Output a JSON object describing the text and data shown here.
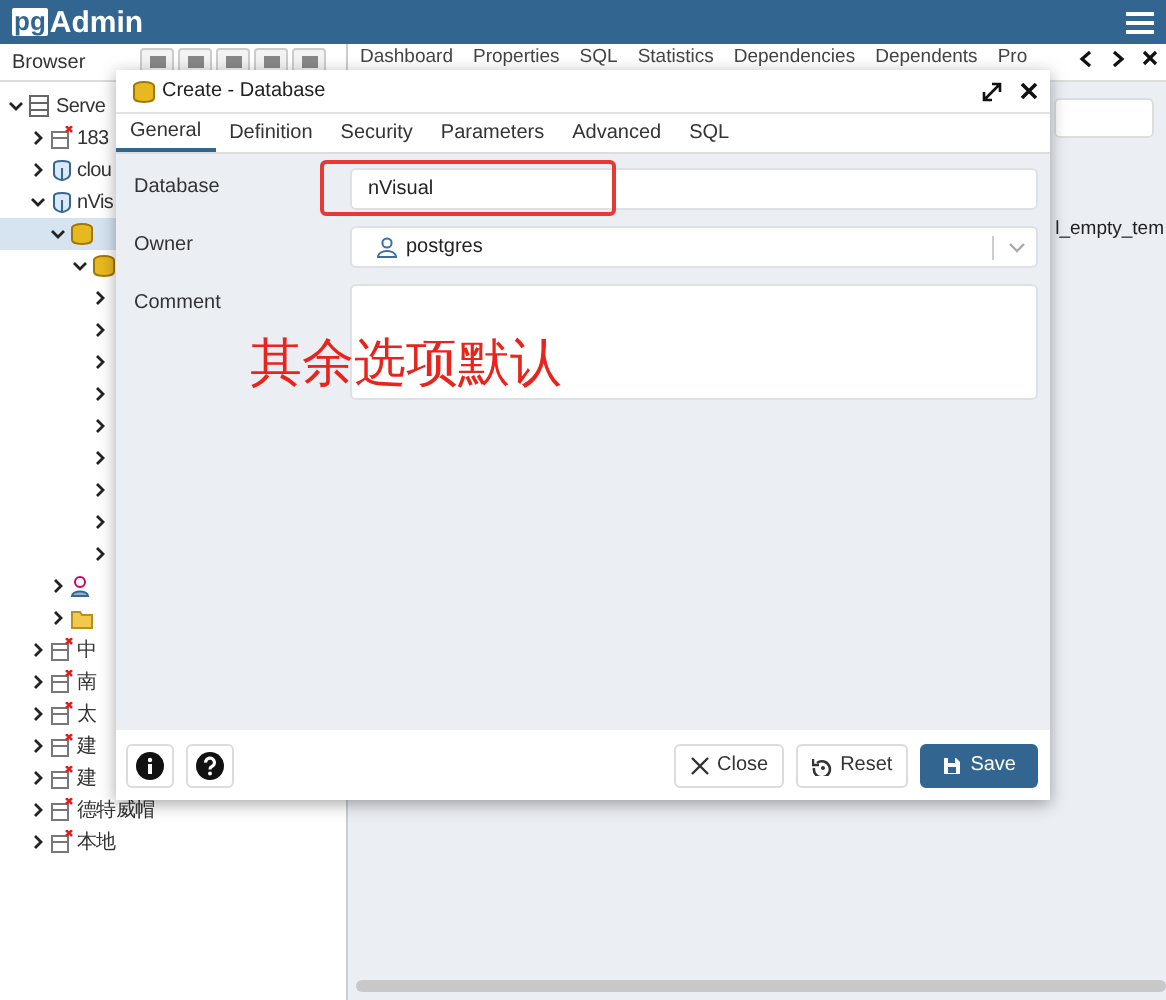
{
  "app": {
    "logo_badge": "pg",
    "logo_text": "Admin"
  },
  "browser": {
    "title": "Browser",
    "tree": [
      {
        "label": "Serve",
        "kind": "group",
        "expanded": true,
        "selected": false,
        "children": [
          {
            "label": "183",
            "kind": "offline",
            "expanded": false,
            "selected": false
          },
          {
            "label": "clou",
            "kind": "server",
            "expanded": false,
            "selected": false
          },
          {
            "label": "nVis",
            "kind": "server",
            "expanded": true,
            "selected": false,
            "children": [
              {
                "kind": "database",
                "expanded": true,
                "selected": true,
                "children": [
                  {
                    "kind": "database",
                    "expanded": true,
                    "selected": false,
                    "children": [
                      {
                        "expanded": false,
                        "selected": false
                      },
                      {
                        "expanded": false,
                        "selected": false
                      },
                      {
                        "expanded": false,
                        "selected": false
                      },
                      {
                        "expanded": false,
                        "selected": false
                      },
                      {
                        "expanded": false,
                        "selected": false
                      },
                      {
                        "expanded": false,
                        "selected": false
                      },
                      {
                        "expanded": false,
                        "selected": false
                      },
                      {
                        "expanded": false,
                        "selected": false
                      },
                      {
                        "expanded": false,
                        "selected": false
                      }
                    ]
                  }
                ]
              },
              {
                "kind": "roles",
                "expanded": false,
                "selected": false
              },
              {
                "kind": "folder",
                "expanded": false,
                "selected": false
              }
            ]
          },
          {
            "label": "中",
            "kind": "offline",
            "expanded": false,
            "selected": false
          },
          {
            "label": "南",
            "kind": "offline",
            "expanded": false,
            "selected": false
          },
          {
            "label": "太",
            "kind": "offline",
            "expanded": false,
            "selected": false
          },
          {
            "label": "建",
            "kind": "offline",
            "expanded": false,
            "selected": false
          },
          {
            "label": "建",
            "kind": "offline",
            "expanded": false,
            "selected": false
          },
          {
            "label": "德特威帽",
            "kind": "offline",
            "expanded": false,
            "selected": false
          },
          {
            "label": "本地",
            "kind": "offline",
            "expanded": false,
            "selected": false
          }
        ]
      }
    ]
  },
  "main": {
    "tabs": [
      {
        "label": "Dashboard",
        "selected": false
      },
      {
        "label": "Properties",
        "selected": false
      },
      {
        "label": "SQL",
        "selected": false
      },
      {
        "label": "Statistics",
        "selected": false
      },
      {
        "label": "Dependencies",
        "selected": false
      },
      {
        "label": "Dependents",
        "selected": false
      },
      {
        "label": "Pro",
        "selected": false
      }
    ],
    "template_text": "l_empty_tem"
  },
  "dialog": {
    "title": "Create - Database",
    "tabs": [
      {
        "label": "General",
        "selected": true
      },
      {
        "label": "Definition",
        "selected": false
      },
      {
        "label": "Security",
        "selected": false
      },
      {
        "label": "Parameters",
        "selected": false
      },
      {
        "label": "Advanced",
        "selected": false
      },
      {
        "label": "SQL",
        "selected": false
      }
    ],
    "fields": [
      {
        "label": "Database",
        "kind": "text",
        "value": "nVisual",
        "highlighted": true
      },
      {
        "label": "Owner",
        "kind": "select",
        "value": "postgres",
        "highlighted": false
      },
      {
        "label": "Comment",
        "kind": "textarea",
        "highlighted": false
      }
    ],
    "annotation": "其余选项默认",
    "buttons": [
      {
        "label": "Close",
        "kind": "close"
      },
      {
        "label": "Reset",
        "kind": "reset"
      },
      {
        "label": "Save",
        "kind": "save"
      }
    ]
  }
}
